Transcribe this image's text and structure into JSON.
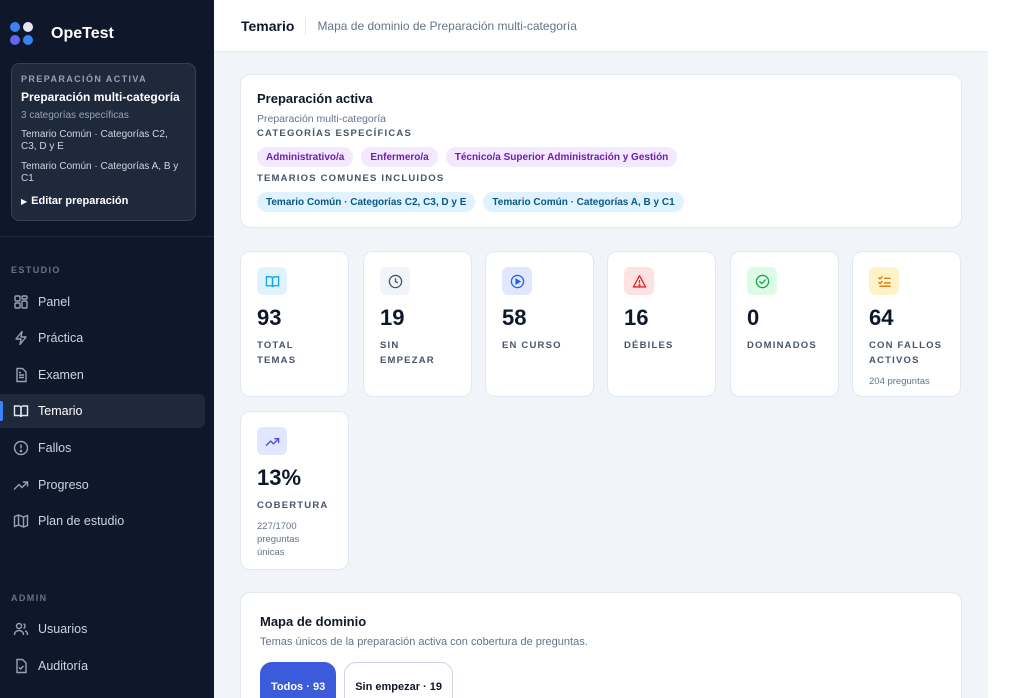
{
  "brand": {
    "name": "OpeTest"
  },
  "prep": {
    "kicker": "PREPARACIÓN ACTIVA",
    "title": "Preparación multi-categoría",
    "sub": "3 categorías específicas",
    "lines": [
      "Temario Común · Categorías C2, C3, D y E",
      "Temario Común · Categorías A, B y C1"
    ],
    "edit": "Editar preparación"
  },
  "nav": {
    "study_label": "ESTUDIO",
    "study": [
      {
        "label": "Panel",
        "icon": "grid-icon"
      },
      {
        "label": "Práctica",
        "icon": "bolt-icon"
      },
      {
        "label": "Examen",
        "icon": "document-icon"
      },
      {
        "label": "Temario",
        "icon": "book-icon",
        "active": true
      },
      {
        "label": "Fallos",
        "icon": "alert-circle-icon"
      },
      {
        "label": "Progreso",
        "icon": "trend-icon"
      },
      {
        "label": "Plan de estudio",
        "icon": "map-icon"
      }
    ],
    "admin_label": "ADMIN",
    "admin": [
      {
        "label": "Usuarios",
        "icon": "users-icon"
      },
      {
        "label": "Auditoría",
        "icon": "audit-icon"
      }
    ]
  },
  "topbar": {
    "title": "Temario",
    "subtitle": "Mapa de dominio de Preparación multi-categoría"
  },
  "active": {
    "title": "Preparación activa",
    "sub": "Preparación multi-categoría",
    "cat_label": "CATEGORÍAS ESPECÍFICAS",
    "categories": [
      "Administrativo/a",
      "Enfermero/a",
      "Técnico/a Superior Administración y Gestión"
    ],
    "common_label": "TEMARIOS COMUNES INCLUIDOS",
    "commons": [
      "Temario Común · Categorías C2, C3, D y E",
      "Temario Común · Categorías A, B y C1"
    ]
  },
  "stats": [
    {
      "value": "93",
      "label": "TOTAL TEMAS",
      "note": "",
      "icon": "book-icon",
      "color": "#0ea5e9",
      "bg": "#e0f2fe"
    },
    {
      "value": "19",
      "label": "SIN EMPEZAR",
      "note": "",
      "icon": "clock-icon",
      "color": "#475569",
      "bg": "#f1f5f9"
    },
    {
      "value": "58",
      "label": "EN CURSO",
      "note": "",
      "icon": "play-icon",
      "color": "#2563eb",
      "bg": "#e0e7ff"
    },
    {
      "value": "16",
      "label": "DÉBILES",
      "note": "",
      "icon": "warning-icon",
      "color": "#dc2626",
      "bg": "#fee2e2"
    },
    {
      "value": "0",
      "label": "DOMINADOS",
      "note": "",
      "icon": "check-circle-icon",
      "color": "#16a34a",
      "bg": "#dcfce7"
    },
    {
      "value": "64",
      "label": "CON FALLOS ACTIVOS",
      "note": "204 preguntas",
      "icon": "list-check-icon",
      "color": "#d97706",
      "bg": "#fef3c7"
    },
    {
      "value": "13%",
      "label": "COBERTURA",
      "note": "227/1700 preguntas únicas",
      "icon": "trend-icon",
      "color": "#4f46e5",
      "bg": "#e0e7ff"
    }
  ],
  "map": {
    "title": "Mapa de dominio",
    "sub": "Temas únicos de la preparación activa con cobertura de preguntas.",
    "filters": [
      "Todos · 93",
      "Sin empezar · 19"
    ]
  }
}
